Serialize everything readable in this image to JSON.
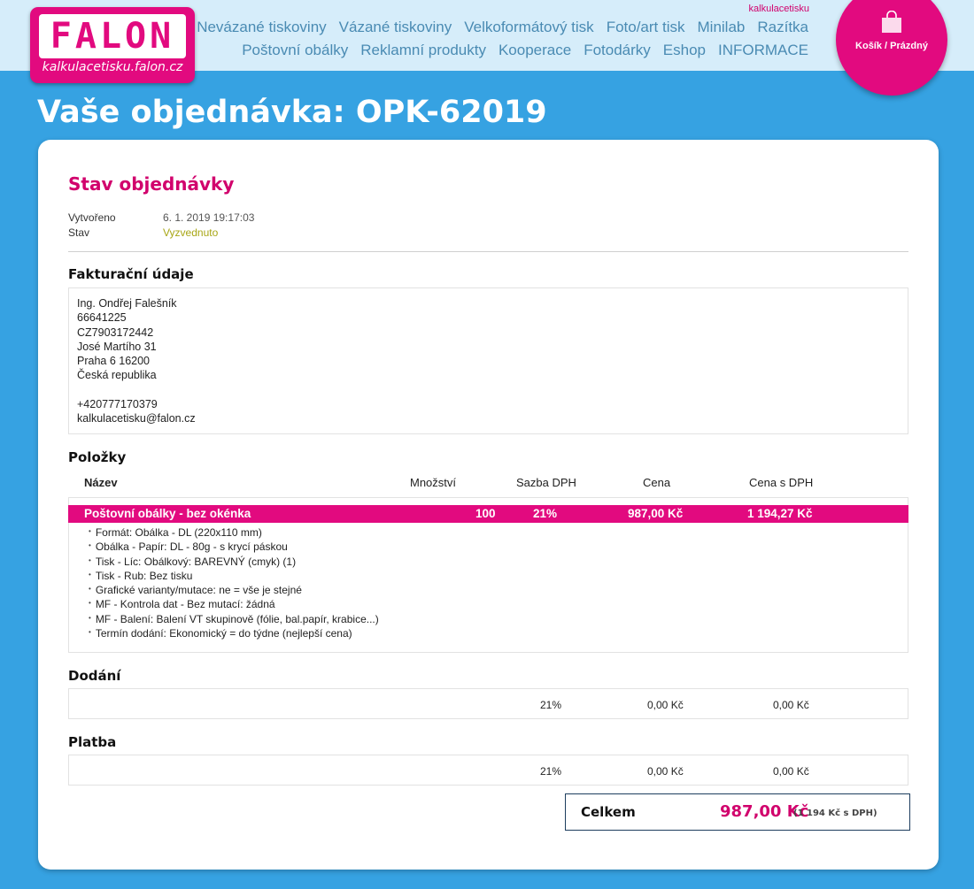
{
  "logo": {
    "word": "FALON",
    "domain": "kalkulacetisku.falon.cz"
  },
  "nav": {
    "user": "kalkulacetisku",
    "row1": [
      "Nevázané tiskoviny",
      "Vázané tiskoviny",
      "Velkoformátový tisk",
      "Foto/art tisk",
      "Minilab",
      "Razítka"
    ],
    "row2": [
      "Poštovní obálky",
      "Reklamní produkty",
      "Kooperace",
      "Fotodárky",
      "Eshop",
      "INFORMACE"
    ]
  },
  "cart": {
    "label": "Košík / Prázdný",
    "icon": "shopping-bag-icon"
  },
  "page_title": "Vaše objednávka: OPK-62019",
  "order_status": {
    "title": "Stav objednávky",
    "created_label": "Vytvořeno",
    "created_value": "6. 1. 2019 19:17:03",
    "status_label": "Stav",
    "status_value": "Vyzvednuto"
  },
  "billing": {
    "title": "Fakturační údaje",
    "lines": [
      "Ing. Ondřej Falešník",
      "66641225",
      "CZ7903172442",
      "José Martího 31",
      "Praha 6 16200",
      "Česká republika",
      "",
      "+420777170379",
      "kalkulacetisku@falon.cz"
    ]
  },
  "items": {
    "title": "Položky",
    "headers": {
      "name": "Název",
      "qty": "Množství",
      "vat": "Sazba DPH",
      "price": "Cena",
      "price_vat": "Cena s DPH"
    },
    "rows": [
      {
        "name": "Poštovní obálky - bez okénka",
        "qty": "100",
        "vat": "21%",
        "price": "987,00 Kč",
        "price_vat": "1 194,27 Kč",
        "attributes": [
          "Formát: Obálka - DL (220x110 mm)",
          "Obálka - Papír: DL - 80g - s krycí páskou",
          "Tisk - Líc: Obálkový: BAREVNÝ (cmyk) (1)",
          "Tisk - Rub: Bez tisku",
          "Grafické varianty/mutace: ne = vše je stejné",
          "MF - Kontrola dat - Bez mutací: žádná",
          "MF - Balení: Balení VT skupinově (fólie, bal.papír, krabice...)",
          "Termín dodání: Ekonomický = do týdne (nejlepší cena)"
        ]
      }
    ]
  },
  "delivery": {
    "title": "Dodání",
    "vat": "21%",
    "price": "0,00 Kč",
    "price_vat": "0,00 Kč"
  },
  "payment": {
    "title": "Platba",
    "vat": "21%",
    "price": "0,00 Kč",
    "price_vat": "0,00 Kč"
  },
  "total": {
    "label": "Celkem",
    "amount": "987,00 Kč",
    "with_vat": "(1 194 Kč s DPH)"
  },
  "colors": {
    "brand_pink": "#e20a7f",
    "header_bg": "#d6edfa",
    "page_bg": "#36a2e2",
    "status_green": "#a8a615",
    "nav_link": "#4a8bb3"
  }
}
